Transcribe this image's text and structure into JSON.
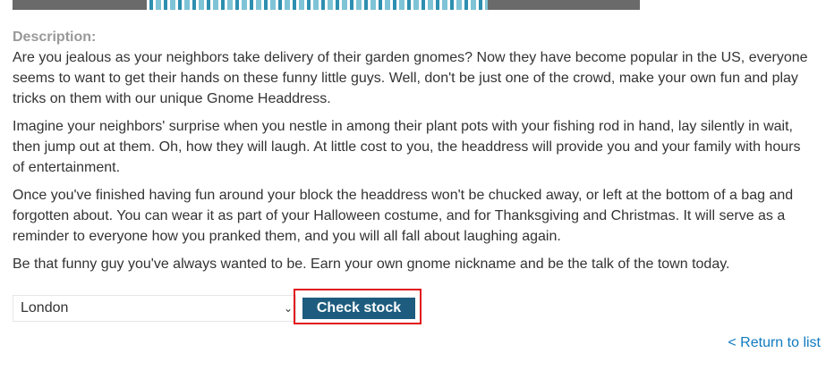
{
  "product": {
    "image_icon": "product-image"
  },
  "description": {
    "label": "Description:",
    "paragraphs": [
      "Are you jealous as your neighbors take delivery of their garden gnomes? Now they have become popular in the US, everyone seems to want to get their hands on these funny little guys. Well, don't be just one of the crowd, make your own fun and play tricks on them with our unique Gnome Headdress.",
      "Imagine your neighbors' surprise when you nestle in among their plant pots with your fishing rod in hand, lay silently in wait, then jump out at them. Oh, how they will laugh. At little cost to you, the headdress will provide you and your family with hours of entertainment.",
      "Once you've finished having fun around your block the headdress won't be chucked away, or left at the bottom of a bag and forgotten about. You can wear it as part of your Halloween costume, and for Thanksgiving and Christmas. It will serve as a reminder to everyone how you pranked them, and you will all fall about laughing again.",
      "Be that funny guy you've always wanted to be. Earn your own gnome nickname and be the talk of the town today."
    ]
  },
  "stock": {
    "store_selected": "London",
    "check_label": "Check stock"
  },
  "nav": {
    "return_label": "< Return to list"
  }
}
